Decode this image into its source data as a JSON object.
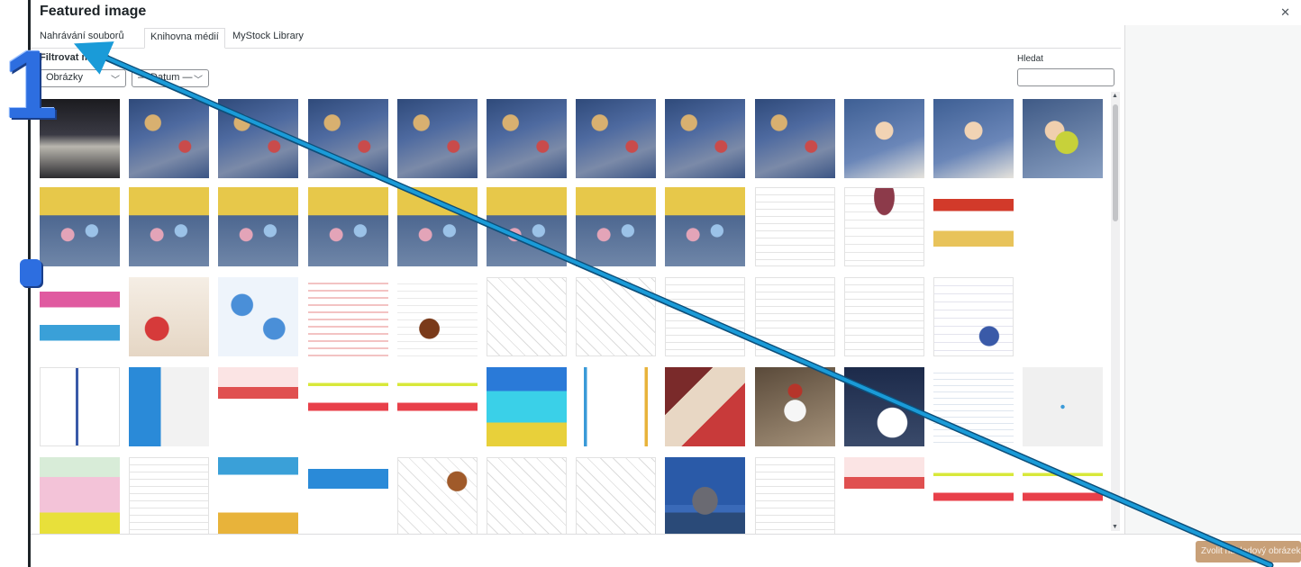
{
  "modal": {
    "title": "Featured image",
    "close_icon": "close-icon"
  },
  "tabs": [
    {
      "label": "Nahrávání souborů",
      "active": false
    },
    {
      "label": "Knihovna médií",
      "active": true
    },
    {
      "label": "MyStock Library",
      "active": false
    }
  ],
  "filters": {
    "label": "Filtrovat média",
    "type_value": "Obrázky",
    "date_value": "— Datum —"
  },
  "search": {
    "label": "Hledat",
    "value": ""
  },
  "footer": {
    "set_button_label": "Zvolit náhledový obrázek"
  },
  "annotation": {
    "step_label": "1",
    "arrow_color": "#1a9bd8",
    "marker_color": "#2d6ee0"
  },
  "colors": {
    "accent": "#2271b1",
    "button_disabled": "#c8a078",
    "sidebar_bg": "#f6f7f7"
  },
  "media_rows": [
    [
      "stage-photo",
      "classroom-photo",
      "classroom-photo",
      "classroom-photo",
      "classroom-photo",
      "classroom-photo",
      "classroom-photo",
      "classroom-photo",
      "classroom-photo",
      "child-photo",
      "child-photo",
      "toy-photo"
    ],
    [
      "classroom-yellow-photo",
      "classroom-yellow-photo",
      "classroom-yellow-photo",
      "classroom-yellow-photo",
      "classroom-yellow-photo",
      "classroom-yellow-photo",
      "classroom-yellow-photo",
      "classroom-yellow-photo",
      "document",
      "poster-document",
      "open-day-poster"
    ],
    [
      "ball-poster",
      "christmas-poster",
      "snowflake-art",
      "text-poster",
      "chestnut-poster",
      "worksheet",
      "worksheet",
      "document",
      "document",
      "document",
      "logo-document"
    ],
    [
      "document-side",
      "sport-logo",
      "event-poster",
      "enrollment-poster",
      "enrollment-poster",
      "open-day-car-poster",
      "certificate",
      "collage-poster",
      "snowman-photo",
      "snow-photo",
      "webpage-screenshot",
      "blank"
    ],
    [
      "pink-poster",
      "document",
      "comic-poster",
      "sport-banner",
      "worksheet-poster",
      "worksheet",
      "worksheet",
      "tower-bridge-photo",
      "document",
      "event-poster",
      "enrollment-poster",
      "enrollment-poster"
    ]
  ]
}
